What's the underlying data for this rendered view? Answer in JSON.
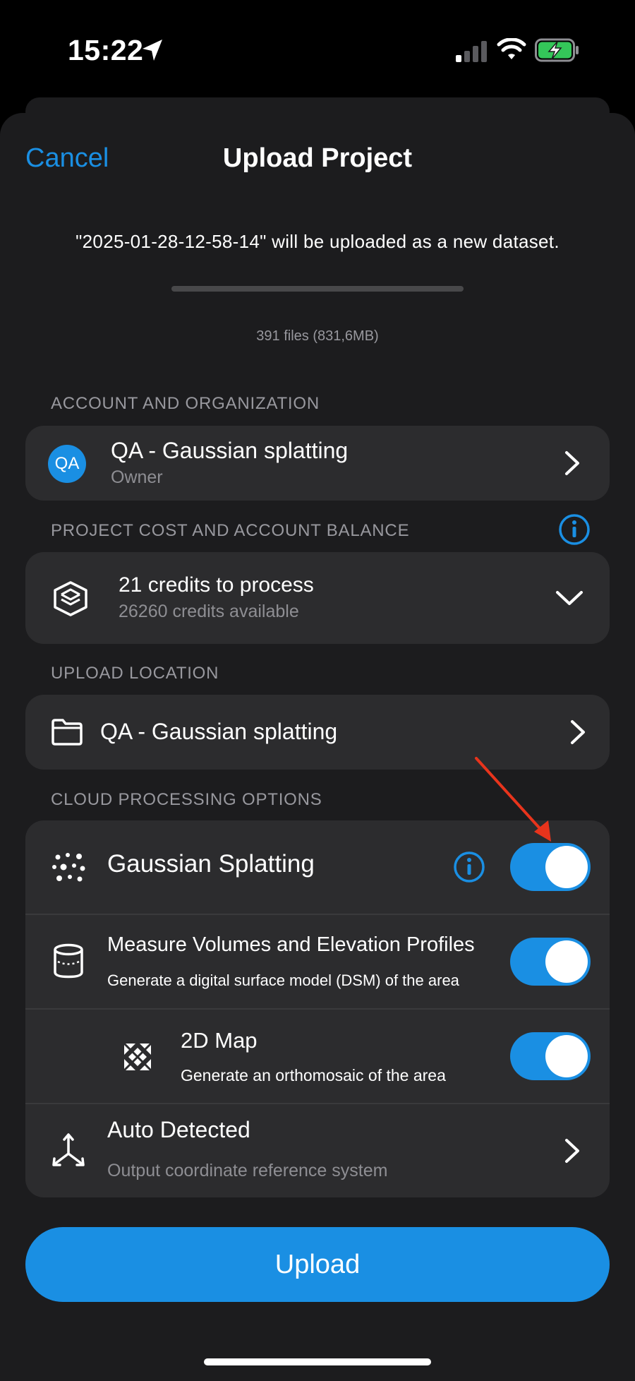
{
  "status_bar": {
    "time": "15:22"
  },
  "header": {
    "cancel_label": "Cancel",
    "title": "Upload Project"
  },
  "notice": {
    "text": "\"2025-01-28-12-58-14\" will be uploaded as a new dataset.",
    "progress": 0,
    "files_summary": "391 files (831,6MB)"
  },
  "account": {
    "section_label": "ACCOUNT AND ORGANIZATION",
    "avatar_initials": "QA",
    "name": "QA - Gaussian splatting",
    "role": "Owner"
  },
  "cost": {
    "section_label": "PROJECT COST AND ACCOUNT BALANCE",
    "credits_to_process": "21 credits to process",
    "credits_available": "26260 credits available"
  },
  "location": {
    "section_label": "UPLOAD LOCATION",
    "folder_name": "QA - Gaussian splatting"
  },
  "processing": {
    "section_label": "CLOUD PROCESSING OPTIONS",
    "gaussian": {
      "label": "Gaussian Splatting",
      "enabled": true
    },
    "volumes": {
      "label": "Measure Volumes and Elevation Profiles",
      "description": "Generate a digital surface model (DSM) of the area",
      "enabled": true
    },
    "map2d": {
      "label": "2D Map",
      "description": "Generate an orthomosaic of the area",
      "enabled": true
    },
    "crs": {
      "label": "Auto Detected",
      "description": "Output coordinate reference system"
    }
  },
  "upload_button_label": "Upload",
  "colors": {
    "accent": "#1a8fe3",
    "annotation_arrow": "#e8341c",
    "battery_fill": "#34c759"
  },
  "icons": [
    "location-arrow-icon",
    "cellular-signal-icon",
    "wifi-icon",
    "battery-charging-icon",
    "chevron-right-icon",
    "info-icon",
    "layers-icon",
    "chevron-down-icon",
    "folder-icon",
    "gaussian-splat-icon",
    "cylinder-icon",
    "map-2d-icon",
    "axes-icon"
  ]
}
